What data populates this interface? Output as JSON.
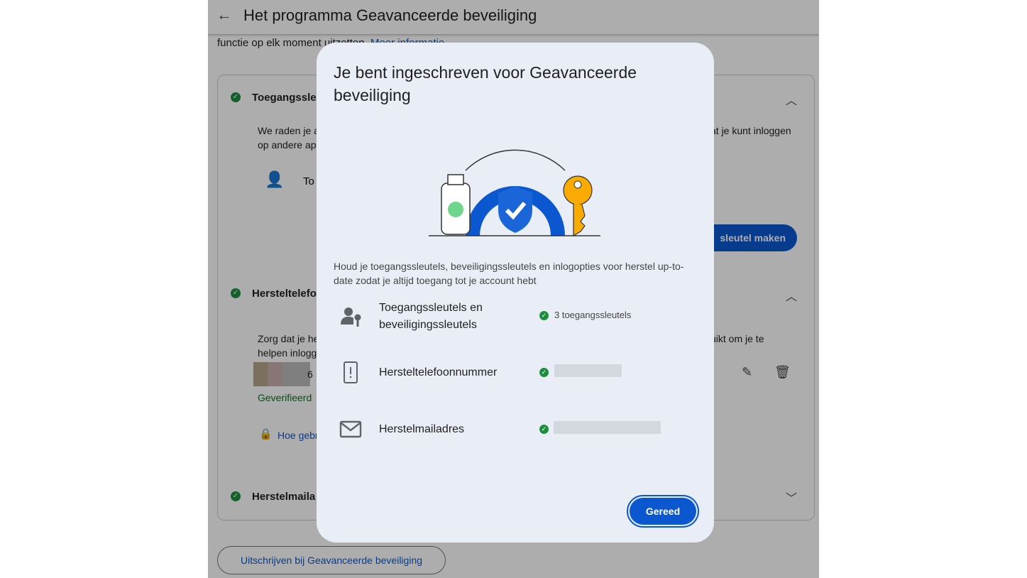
{
  "page": {
    "title": "Het programma Geavanceerde beveiliging",
    "intro": "functie op elk moment uitzetten.",
    "intro_link": "Meer informatie",
    "sections": [
      {
        "title": "Toegangssle",
        "desc1": "We raden je a",
        "desc1_right": "at je kunt inloggen",
        "desc2": "op andere app",
        "item": "To",
        "button": "sleutel maken"
      },
      {
        "title": "Hersteltelefo",
        "desc1": "Zorg dat je he",
        "desc1_right": "uikt om je te",
        "desc2": "helpen inlogg",
        "phone_fragment": "6",
        "status": "Geverifieerd",
        "link": "Hoe gebr"
      },
      {
        "title": "Herstelmaila"
      }
    ],
    "unsubscribe": "Uitschrijven bij Geavanceerde beveiliging"
  },
  "modal": {
    "title": "Je bent ingeschreven voor Geavanceerde beveiliging",
    "description": "Houd je toegangssleutels, beveiligingssleutels en inlogopties voor herstel up-to-date zodat je altijd toegang tot je account hebt",
    "rows": [
      {
        "icon": "passkey-icon",
        "label": "Toegangssleutels en beveiligingssleutels",
        "value": "3 toegangssleutels"
      },
      {
        "icon": "phone-icon",
        "label": "Hersteltelefoonnummer",
        "value": ""
      },
      {
        "icon": "mail-icon",
        "label": "Herstelmailadres",
        "value": ""
      }
    ],
    "done": "Gereed"
  },
  "colors": {
    "accent": "#0b57d0",
    "success": "#1e8e3e",
    "modal_bg": "#e9eef6"
  }
}
